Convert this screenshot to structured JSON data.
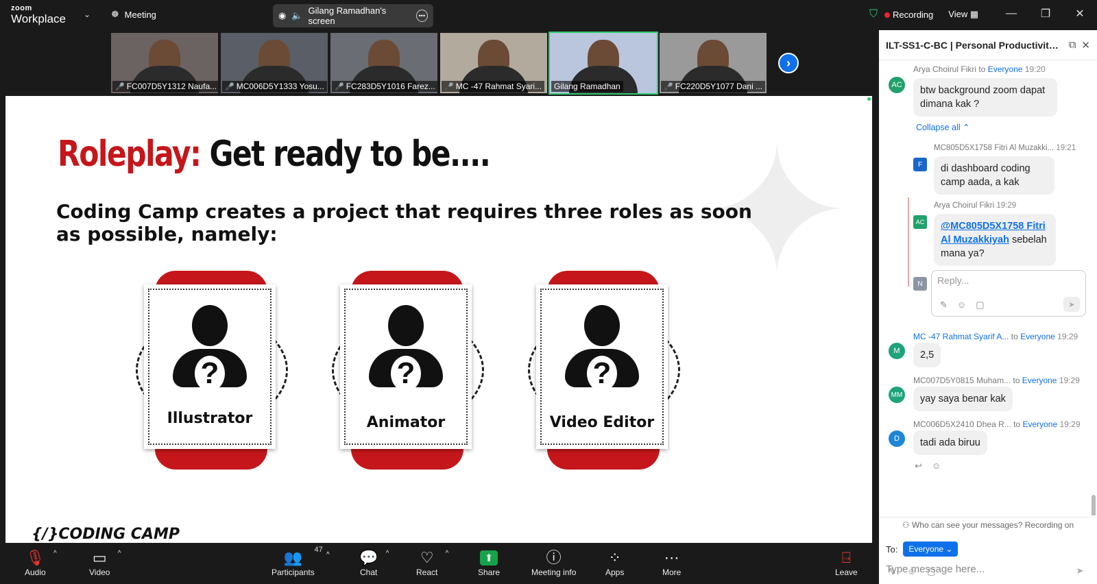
{
  "topbar": {
    "brand_top": "zoom",
    "brand_bottom": "Workplace",
    "meeting_label": "Meeting",
    "screen_label": "Gilang Ramadhan's screen",
    "recording_label": "Recording",
    "view_label": "View"
  },
  "participants_strip": [
    {
      "name": "FC007D5Y1312 Naufa...",
      "muted": true,
      "bg": "#6b6262"
    },
    {
      "name": "MC006D5Y1333 Yosu...",
      "muted": true,
      "bg": "#5a5e66"
    },
    {
      "name": "FC283D5Y1016 Farez...",
      "muted": true,
      "bg": "#6a6e74"
    },
    {
      "name": "MC -47 Rahmat Syari...",
      "muted": true,
      "bg": "#b3aa9e"
    },
    {
      "name": "Gilang Ramadhan",
      "muted": false,
      "bg": "#b9c6de",
      "active": true
    },
    {
      "name": "FC220D5Y1077 Dani ...",
      "muted": true,
      "bg": "#9a9a9a"
    }
  ],
  "slide": {
    "title_red": "Roleplay:",
    "title_black": " Get ready to be....",
    "body": "Coding Camp creates a project that requires three roles as soon as possible, namely:",
    "roles": [
      "Illustrator",
      "Animator",
      "Video Editor"
    ],
    "logo": "{/}CODING CAMP"
  },
  "toolbar": {
    "audio": "Audio",
    "video": "Video",
    "participants": "Participants",
    "participants_count": "47",
    "chat": "Chat",
    "react": "React",
    "share": "Share",
    "meeting_info": "Meeting info",
    "apps": "Apps",
    "more": "More",
    "leave": "Leave"
  },
  "chat_panel": {
    "title": "ILT-SS1-C-BC | Personal Productivity: ...",
    "messages": [
      {
        "sender": "Arya Choirul Fikri",
        "to": "to",
        "target": "Everyone",
        "time": "19:20",
        "text": "btw background zoom dapat dimana kak ?",
        "initials": "AC",
        "color": "#22a06b"
      },
      {
        "collapse": "Collapse all"
      },
      {
        "sender": "MC805D5X1758 Fitri Al Muzakki...",
        "time": "19:21",
        "text": "di dashboard coding camp aada, a kak",
        "initials": "F",
        "color": "#1a66c9"
      },
      {
        "sender": "Arya Choirul Fikri",
        "time": "19:29",
        "mention": "@MC805D5X1758 Fitri Al Muzakkiyah",
        "text": " sebelah mana ya?",
        "initials": "AC",
        "color": "#22a06b"
      },
      {
        "reply_placeholder": "Reply...",
        "initials": "N",
        "color": "#8a96a3"
      },
      {
        "sender": "MC -47 Rahmat Syarif A...",
        "to": "to",
        "target": "Everyone",
        "time": "19:29",
        "text": "2,5",
        "initials": "M",
        "color": "#1fa37b"
      },
      {
        "sender": "MC007D5Y0815 Muham...",
        "to": "to",
        "target": "Everyone",
        "time": "19:29",
        "text": "yay saya benar kak",
        "initials": "MM",
        "color": "#1fa37b"
      },
      {
        "sender": "MC006D5X2410 Dhea R...",
        "to": "to",
        "target": "Everyone",
        "time": "19:29",
        "text": "tadi ada biruu",
        "initials": "D",
        "color": "#1d86d6"
      }
    ],
    "notice": "Who can see your messages? Recording on",
    "to_label": "To:",
    "to_value": "Everyone",
    "input_placeholder": "Type message here..."
  }
}
